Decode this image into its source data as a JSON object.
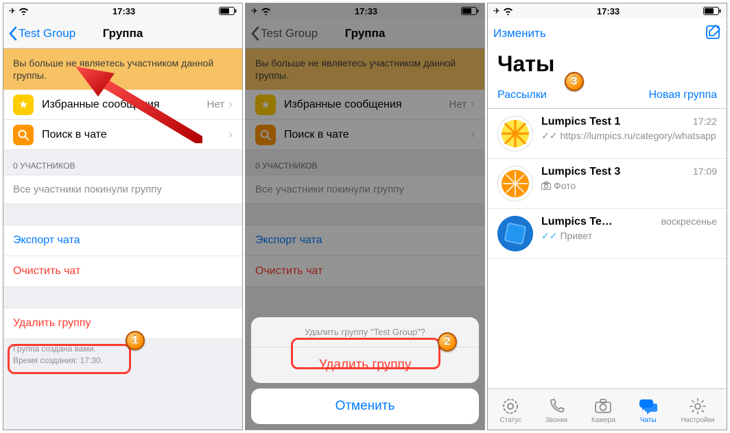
{
  "status": {
    "time": "17:33"
  },
  "screen1": {
    "back_label": "Test Group",
    "title": "Группа",
    "banner": "Вы больше не являетесь участником данной группы.",
    "favorites_label": "Избранные сообщения",
    "favorites_extra": "Нет",
    "search_label": "Поиск в чате",
    "members_header": "0 УЧАСТНИКОВ",
    "members_empty": "Все участники покинули группу",
    "export_label": "Экспорт чата",
    "clear_label": "Очистить чат",
    "delete_label": "Удалить группу",
    "footer_line1": "Группа создана вами.",
    "footer_line2": "Время создания: 17:30."
  },
  "screen2": {
    "sheet_title": "Удалить группу \"Test Group\"?",
    "sheet_delete": "Удалить группу",
    "sheet_cancel": "Отменить"
  },
  "screen3": {
    "edit_label": "Изменить",
    "big_title": "Чаты",
    "broadcast_label": "Рассылки",
    "newgroup_label": "Новая группа",
    "chats": [
      {
        "name": "Lumpics Test 1",
        "time": "17:22",
        "msg": "https://lumpics.ru/category/whatsapp",
        "ticks": "sent"
      },
      {
        "name": "Lumpics Test 3",
        "time": "17:09",
        "msg": "Фото",
        "icon": "camera"
      },
      {
        "name": "Lumpics Te…",
        "time": "воскресенье",
        "msg": "Привет",
        "ticks": "read"
      }
    ],
    "tabs": {
      "status": "Статус",
      "calls": "Звонки",
      "camera": "Камера",
      "chats": "Чаты",
      "settings": "Настройки"
    }
  },
  "callouts": {
    "one": "1",
    "two": "2",
    "three": "3"
  }
}
